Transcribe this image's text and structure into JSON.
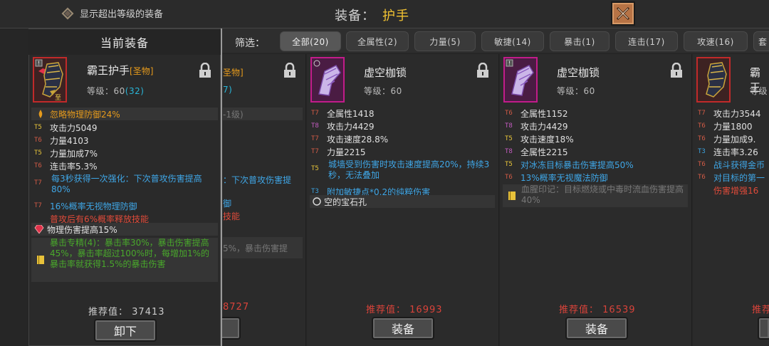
{
  "topbar": {
    "show_over_level_label": "显示超出等级的装备",
    "title_prefix": "装备：",
    "slot_name": "护手"
  },
  "filter": {
    "label": "筛选：",
    "tabs": [
      "全部(20)",
      "全属性(2)",
      "力量(5)",
      "敏捷(14)",
      "暴击(1)",
      "连击(17)",
      "攻速(16)",
      "套"
    ]
  },
  "current": {
    "header": "当前装备",
    "name": "霸王护手",
    "grade": "[圣物]",
    "level_label": "等级：",
    "level": "60",
    "level_bonus": "(32)",
    "special_affix": "忽略物理防御24%",
    "stats": [
      {
        "tier": "T5",
        "text": "攻击力5049"
      },
      {
        "tier": "T6",
        "text": "力量4103"
      },
      {
        "tier": "T5",
        "text": "力量加成7%"
      },
      {
        "tier": "T6",
        "text": "连击率5.3%"
      },
      {
        "tier": "T7",
        "text": "每3秒获得一次强化：下次普攻伤害提高80%"
      },
      {
        "tier": "T7",
        "text": "16%概率无视物理防御"
      }
    ],
    "red_text": "普攻后有6%概率释放技能",
    "gem_text": "物理伤害提高15%",
    "set_text": "暴击专精(4)：暴击率30%，暴击伤害提高45%，暴击率超过100%时，每增加1%的暴击率就获得1.5%的暴击伤害",
    "rec_label": "推荐值：",
    "rec_value": "37413",
    "button": "卸下"
  },
  "behind": {
    "grade_fragment": "圣物]",
    "level_fragment": "7)",
    "level_req_fragment": "-1级)",
    "skill_fragment": "：下次普攻伤害提",
    "def_fragment": "御",
    "red_fragment": "技能",
    "set_fragment": "5%，暴击伤害提",
    "rec_fragment": "8727"
  },
  "cards": [
    {
      "name": "虚空枷锁",
      "level_label": "等级：",
      "level": "60",
      "stats": [
        {
          "tier": "T7",
          "text": "全属性1418",
          "cls": ""
        },
        {
          "tier": "T8",
          "text": "攻击力4429",
          "cls": ""
        },
        {
          "tier": "T7",
          "text": "攻击速度28.8%",
          "cls": ""
        },
        {
          "tier": "T7",
          "text": "力量2215",
          "cls": ""
        },
        {
          "tier": "T5",
          "text": "城墙受到伤害时攻击速度提高20%，持续3秒，无法叠加",
          "cls": "blue"
        },
        {
          "tier": "T3",
          "text": "附加敏捷点*0.2的纯粹伤害",
          "cls": "blue"
        }
      ],
      "socket": "空的宝石孔",
      "rec_label": "推荐值：",
      "rec_value": "16993",
      "button": "装备"
    },
    {
      "name": "虚空枷锁",
      "level_label": "等级：",
      "level": "60",
      "stats": [
        {
          "tier": "T6",
          "text": "全属性1152",
          "cls": ""
        },
        {
          "tier": "T8",
          "text": "攻击力4429",
          "cls": ""
        },
        {
          "tier": "T5",
          "text": "攻击速度18%",
          "cls": ""
        },
        {
          "tier": "T8",
          "text": "全属性2215",
          "cls": ""
        },
        {
          "tier": "T5",
          "text": "对冰冻目标暴击伤害提高50%",
          "cls": "blue"
        },
        {
          "tier": "T6",
          "text": "13%概率无视魔法防御",
          "cls": "blue"
        }
      ],
      "set_text": "血腥印记：目标燃烧或中毒时流血伤害提高40%",
      "rec_label": "推荐值：",
      "rec_value": "16539",
      "button": "装备"
    },
    {
      "name": "霸王",
      "level_label": "等级",
      "stats": [
        {
          "tier": "T7",
          "text": "攻击力3544",
          "cls": ""
        },
        {
          "tier": "T6",
          "text": "力量1800",
          "cls": ""
        },
        {
          "tier": "T6",
          "text": "力量加成9.",
          "cls": ""
        },
        {
          "tier": "T3",
          "text": "连击率3.26",
          "cls": ""
        },
        {
          "tier": "T6",
          "text": "战斗获得金币",
          "cls": "blue"
        },
        {
          "tier": "T6",
          "text": "对目标的第一",
          "cls": "blue"
        }
      ],
      "red_text": "伤害增强16",
      "rec_label": "推荐"
    }
  ]
}
